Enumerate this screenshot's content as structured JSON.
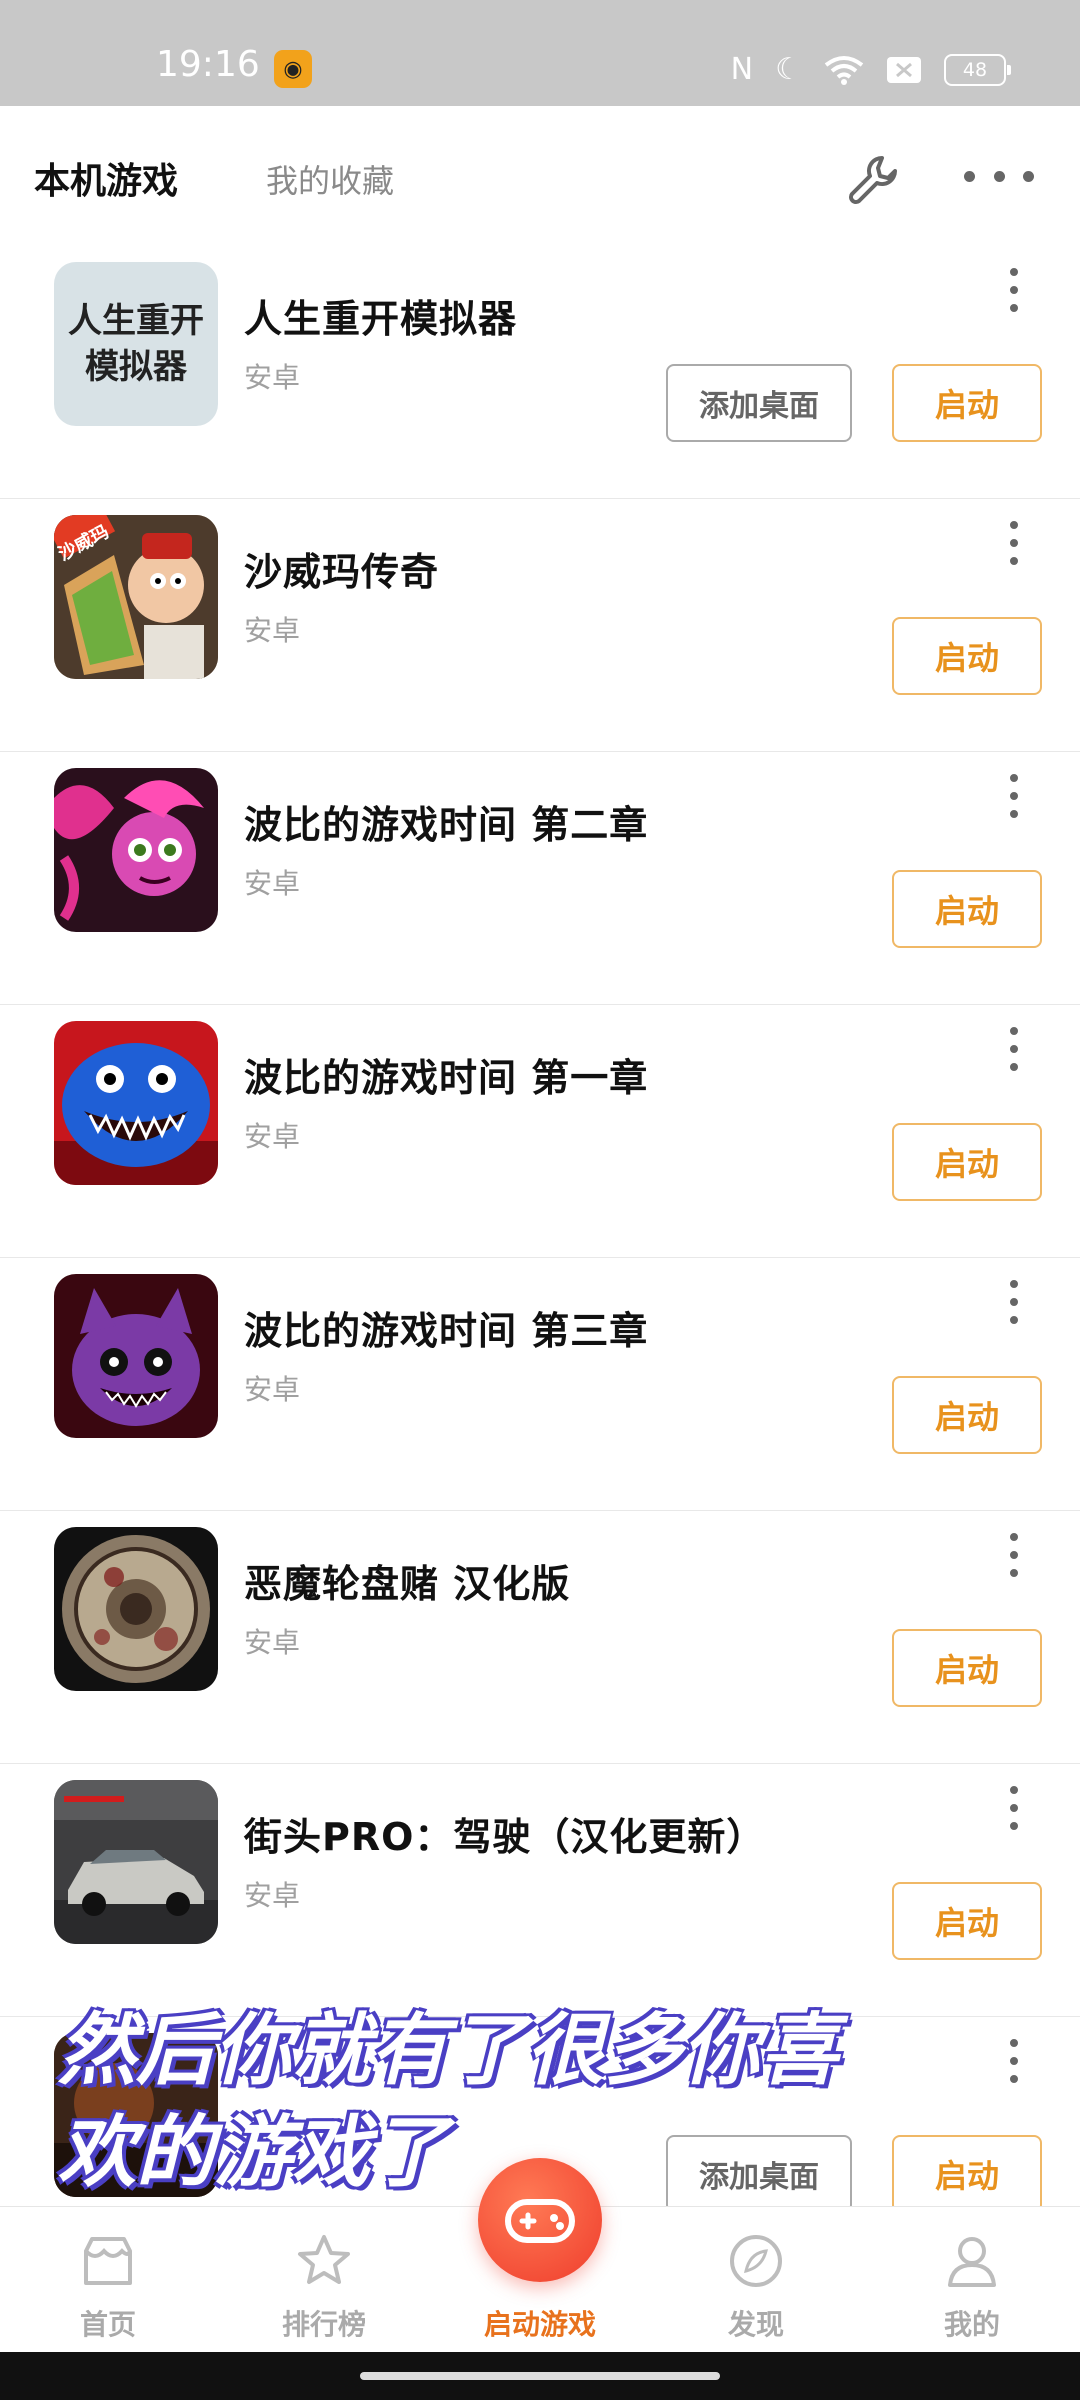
{
  "status_bar": {
    "time": "19:16",
    "battery": "48"
  },
  "header": {
    "tabs": [
      {
        "label": "本机游戏",
        "active": true
      },
      {
        "label": "我的收藏",
        "active": false
      }
    ]
  },
  "games": [
    {
      "title": "人生重开模拟器",
      "platform": "安卓",
      "icon_text": "人生重开模拟器",
      "add_desktop": "添加桌面",
      "launch": "启动"
    },
    {
      "title": "沙威玛传奇",
      "platform": "安卓",
      "icon_text": "沙威玛",
      "launch": "启动"
    },
    {
      "title": "波比的游戏时间 第二章",
      "platform": "安卓",
      "launch": "启动"
    },
    {
      "title": "波比的游戏时间 第一章",
      "platform": "安卓",
      "launch": "启动"
    },
    {
      "title": "波比的游戏时间 第三章",
      "platform": "安卓",
      "launch": "启动"
    },
    {
      "title": "恶魔轮盘赌 汉化版",
      "platform": "安卓",
      "launch": "启动"
    },
    {
      "title": "街头PRO：驾驶（汉化更新）",
      "platform": "安卓",
      "launch": "启动"
    },
    {
      "title": "",
      "platform": "",
      "add_desktop": "添加桌面",
      "launch": "启动"
    }
  ],
  "caption": {
    "line1": "然后你就有了很多你喜",
    "line2": "欢的游戏了"
  },
  "bottom_nav": [
    {
      "label": "首页",
      "icon": "store-icon"
    },
    {
      "label": "排行榜",
      "icon": "star-icon"
    },
    {
      "label": "启动游戏",
      "icon": "gamepad-icon",
      "active": true
    },
    {
      "label": "发现",
      "icon": "compass-icon"
    },
    {
      "label": "我的",
      "icon": "user-icon"
    }
  ],
  "colors": {
    "accent": "#e8921d",
    "active_nav": "#e8721d",
    "fab": "#ef3d2c"
  }
}
